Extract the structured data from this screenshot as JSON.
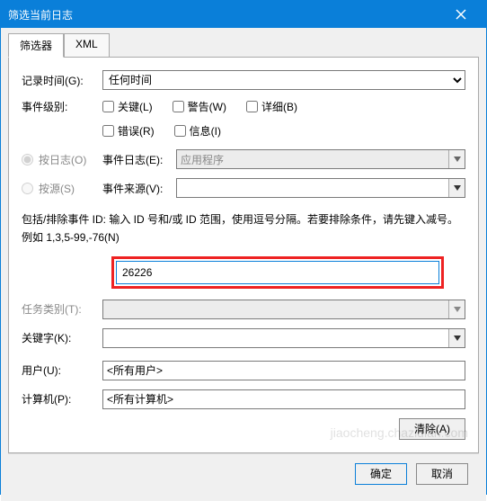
{
  "title": "筛选当前日志",
  "tabs": {
    "filter": "筛选器",
    "xml": "XML"
  },
  "labels": {
    "logged": "记录时间(G):",
    "eventLevel": "事件级别:",
    "byLog": "按日志(O)",
    "bySource": "按源(S)",
    "eventLog": "事件日志(E):",
    "eventSource": "事件来源(V):",
    "taskCategory": "任务类别(T):",
    "keywords": "关键字(K):",
    "user": "用户(U):",
    "computer": "计算机(P):"
  },
  "values": {
    "loggedTime": "任何时间",
    "eventLogValue": "应用程序",
    "eventSourceValue": "",
    "eventId": "26226",
    "taskCategory": "",
    "keywords": "",
    "user": "<所有用户>",
    "computer": "<所有计算机>"
  },
  "levels": {
    "critical": "关键(L)",
    "warning": "警告(W)",
    "verbose": "详细(B)",
    "error": "错误(R)",
    "info": "信息(I)"
  },
  "help": "包括/排除事件 ID: 输入 ID 号和/或 ID 范围，使用逗号分隔。若要排除条件，请先键入减号。例如 1,3,5-99,-76(N)",
  "buttons": {
    "clear": "清除(A)",
    "ok": "确定",
    "cancel": "取消"
  },
  "watermark": "jiaocheng.chazidian.com"
}
